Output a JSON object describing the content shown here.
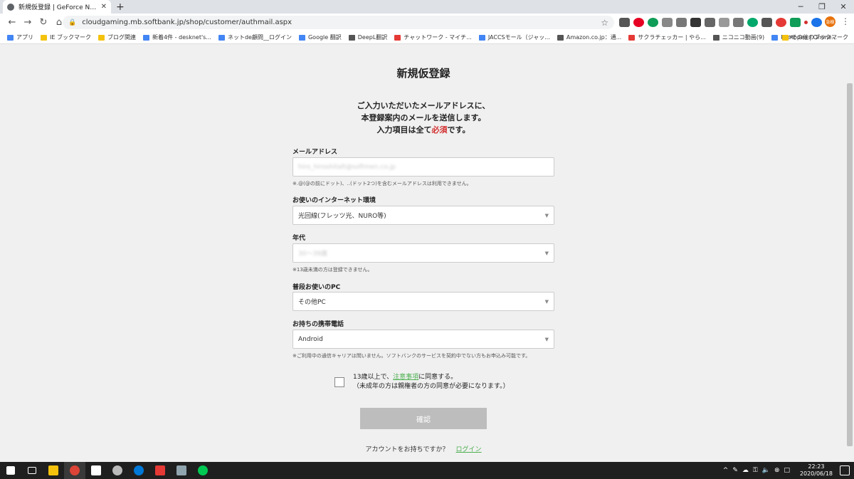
{
  "browser": {
    "tab_title": "新規仮登録 | GeForce NOW Pow...",
    "url": "cloudgaming.mb.softbank.jp/shop/customer/authmail.aspx",
    "profile_label": "急樹",
    "bookmarks": [
      {
        "label": "アプリ",
        "icon": "apps-icon"
      },
      {
        "label": "IE ブックマーク",
        "icon": "folder-icon"
      },
      {
        "label": "ブログ関連",
        "icon": "folder-icon"
      },
      {
        "label": "新着4件 - desknet's...",
        "icon": "desknets-icon"
      },
      {
        "label": "ネットde顧問__ログイン",
        "icon": "site-icon"
      },
      {
        "label": "Google 翻訳",
        "icon": "google-translate-icon"
      },
      {
        "label": "DeepL翻訳",
        "icon": "deepl-icon"
      },
      {
        "label": "チャットワーク - マイチ...",
        "icon": "chatwork-icon"
      },
      {
        "label": "JACCSモール（ジャッ...",
        "icon": "jaccs-icon"
      },
      {
        "label": "Amazon.co.jp：通...",
        "icon": "amazon-icon"
      },
      {
        "label": "サクラチェッカー | やら...",
        "icon": "sakura-icon"
      },
      {
        "label": "ニコニコ動画(9)",
        "icon": "niconico-icon"
      },
      {
        "label": "Photopea | Online...",
        "icon": "photopea-icon"
      }
    ],
    "bookmarks_more": "»",
    "other_bookmarks": "その他のブックマーク"
  },
  "page": {
    "title": "新規仮登録",
    "intro_line1": "ご入力いただいたメールアドレスに、",
    "intro_line2": "本登録案内のメールを送信します。",
    "intro_line3_pre": "入力項目は全て",
    "intro_line3_req": "必須",
    "intro_line3_post": "です。",
    "email": {
      "label": "メールアドレス",
      "value": "hiro_hiroshitalt@softmen.co.jp",
      "note": "※.@(@の前にドット)、..(ドット2つ)を含むメールアドレスは利用できません。"
    },
    "internet": {
      "label": "お使いのインターネット環境",
      "value": "光回線(フレッツ光、NURO等)"
    },
    "age": {
      "label": "年代",
      "value": "30〜39歳",
      "note": "※13歳未満の方は登録できません。"
    },
    "pc": {
      "label": "普段お使いのPC",
      "value": "その他PC"
    },
    "phone": {
      "label": "お持ちの携帯電話",
      "value": "Android",
      "note": "※ご利用中の通信キャリアは問いません。ソフトバンクのサービスを契約中でない方もお申込み可能です。"
    },
    "agree": {
      "pre": "13歳以上で、",
      "link": "注意事項",
      "post": "に同意する。",
      "line2": "（未成年の方は親権者の方の同意が必要になります。）"
    },
    "confirm_label": "確認",
    "account_text": "アカウントをお持ちですか？",
    "login_link": "ログイン"
  },
  "taskbar": {
    "time": "22:23",
    "date": "2020/06/18"
  }
}
